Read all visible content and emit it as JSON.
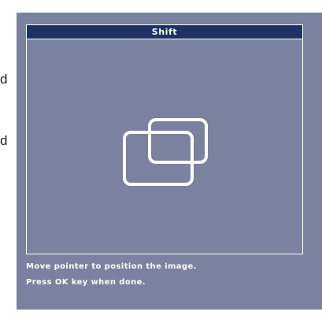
{
  "background_text": {
    "letter_1": "d",
    "letter_2": "d"
  },
  "osd": {
    "title": "Shift",
    "icon": "shift-windows-icon",
    "message_line_1": "Move pointer to position the image.",
    "message_line_2": "Press OK key when done.",
    "colors": {
      "panel": "#7a82a0",
      "title_bar": "#1e3164",
      "text": "#ffffff"
    }
  }
}
